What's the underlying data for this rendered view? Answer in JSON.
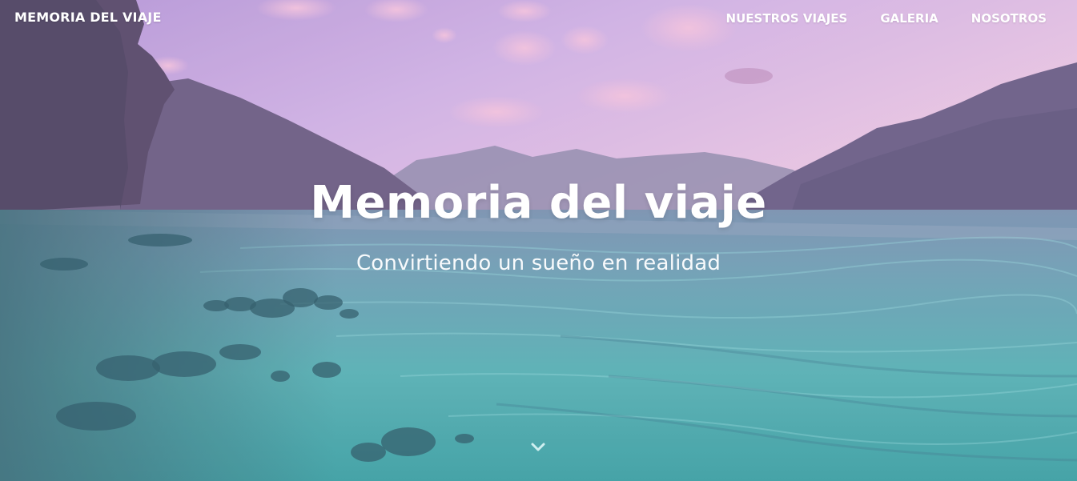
{
  "navbar": {
    "brand": "MEMORIA DEL VIAJE",
    "links": [
      {
        "label": "NUESTROS VIAJES"
      },
      {
        "label": "GALERIA"
      },
      {
        "label": "NOSOTROS"
      }
    ]
  },
  "hero": {
    "title": "Memoria del viaje",
    "subtitle": "Convirtiendo un sueño en realidad",
    "scroll_icon": "chevron-down-icon"
  },
  "colors": {
    "sky_top": "#c9a7e4",
    "sky_bottom": "#f1d3e6",
    "water": "#5fb8b8",
    "text": "#ffffff"
  }
}
